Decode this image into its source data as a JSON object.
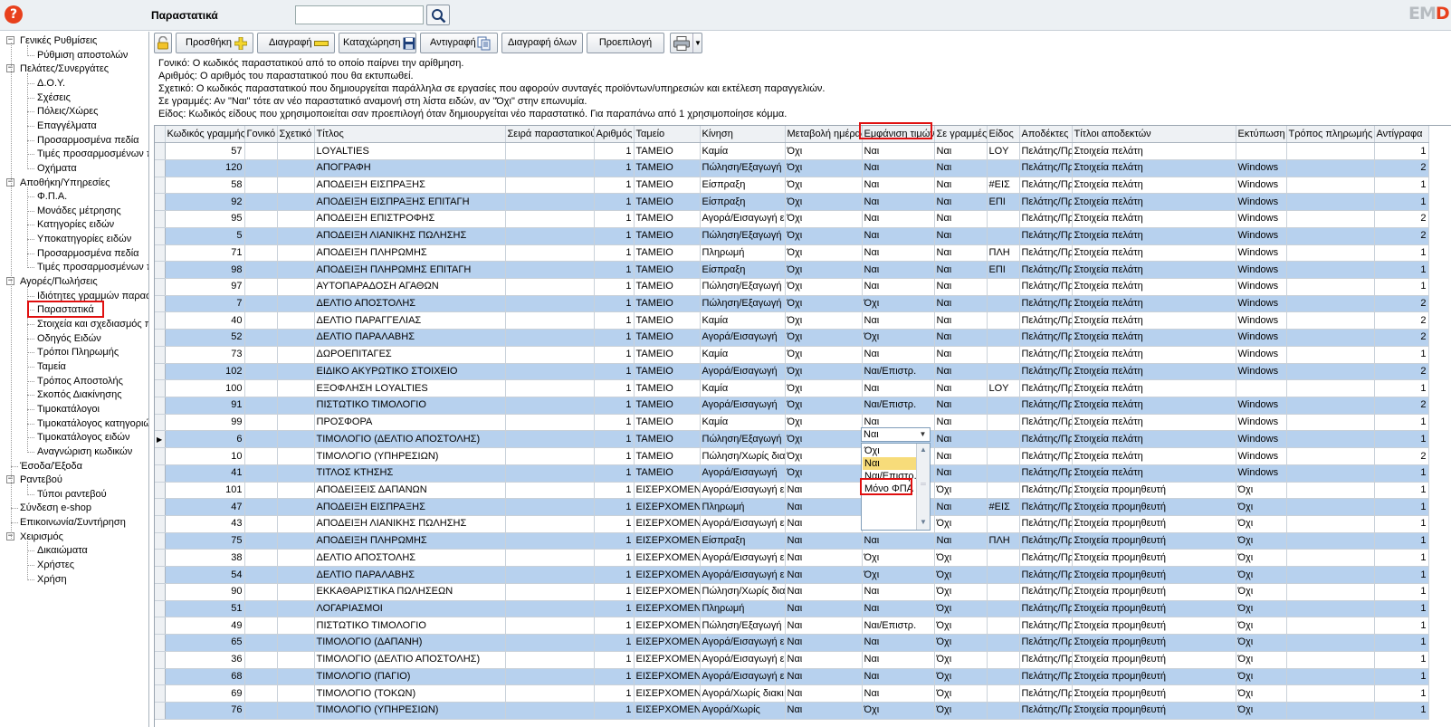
{
  "header": {
    "title": "Παραστατικά",
    "search": {
      "value": "",
      "placeholder": ""
    },
    "logo": {
      "main": "EM",
      "accent": "D"
    }
  },
  "sidebar": {
    "nodes": [
      {
        "label": "Γενικές Ρυθμίσεις",
        "level": 0,
        "toggle": "−"
      },
      {
        "label": "Ρύθμιση αποστολών",
        "level": 1
      },
      {
        "label": "Πελάτες/Συνεργάτες",
        "level": 0,
        "toggle": "−"
      },
      {
        "label": "Δ.Ο.Υ.",
        "level": 1
      },
      {
        "label": "Σχέσεις",
        "level": 1
      },
      {
        "label": "Πόλεις/Χώρες",
        "level": 1
      },
      {
        "label": "Επαγγέλματα",
        "level": 1
      },
      {
        "label": "Προσαρμοσμένα πεδία",
        "level": 1
      },
      {
        "label": "Τιμές προσαρμοσμένων πεδίων",
        "level": 1
      },
      {
        "label": "Οχήματα",
        "level": 1
      },
      {
        "label": "Αποθήκη/Υπηρεσίες",
        "level": 0,
        "toggle": "−"
      },
      {
        "label": "Φ.Π.Α.",
        "level": 1
      },
      {
        "label": "Μονάδες μέτρησης",
        "level": 1
      },
      {
        "label": "Κατηγορίες ειδών",
        "level": 1
      },
      {
        "label": "Υποκατηγορίες ειδών",
        "level": 1
      },
      {
        "label": "Προσαρμοσμένα πεδία",
        "level": 1
      },
      {
        "label": "Τιμές προσαρμοσμένων πεδίων",
        "level": 1
      },
      {
        "label": "Αγορές/Πωλήσεις",
        "level": 0,
        "toggle": "−"
      },
      {
        "label": "Ιδιότητες γραμμών παραστατικών",
        "level": 1
      },
      {
        "label": "Παραστατικά",
        "level": 1,
        "selected": true
      },
      {
        "label": "Στοιχεία και σχεδιασμός παραστατικών",
        "level": 1
      },
      {
        "label": "Οδηγός Ειδών",
        "level": 1
      },
      {
        "label": "Τρόποι Πληρωμής",
        "level": 1
      },
      {
        "label": "Ταμεία",
        "level": 1
      },
      {
        "label": "Τρόπος Αποστολής",
        "level": 1
      },
      {
        "label": "Σκοπός Διακίνησης",
        "level": 1
      },
      {
        "label": "Τιμοκατάλογοι",
        "level": 1
      },
      {
        "label": "Τιμοκατάλογος κατηγοριών",
        "level": 1
      },
      {
        "label": "Τιμοκατάλογος ειδών",
        "level": 1
      },
      {
        "label": "Αναγνώριση κωδικών",
        "level": 1
      },
      {
        "label": "Έσοδα/Έξοδα",
        "level": 0
      },
      {
        "label": "Ραντεβού",
        "level": 0,
        "toggle": "−"
      },
      {
        "label": "Τύποι ραντεβού",
        "level": 1
      },
      {
        "label": "Σύνδεση e-shop",
        "level": 0
      },
      {
        "label": "Επικοινωνία/Συντήρηση",
        "level": 0
      },
      {
        "label": "Χειρισμός",
        "level": 0,
        "toggle": "−"
      },
      {
        "label": "Δικαιώματα",
        "level": 1
      },
      {
        "label": "Χρήστες",
        "level": 1
      },
      {
        "label": "Χρήση",
        "level": 1
      }
    ]
  },
  "toolbar": {
    "add": "Προσθήκη",
    "delete": "Διαγραφή",
    "save": "Καταχώρηση",
    "copy": "Αντιγραφή",
    "delete_all": "Διαγραφή όλων",
    "default": "Προεπιλογή"
  },
  "info": [
    "Γονικό: Ο κωδικός παραστατικού από το οποίο παίρνει την αρίθμηση.",
    "Αριθμός: Ο αριθμός του παραστατικού που θα εκτυπωθεί.",
    "Σχετικό: Ο κωδικός παραστατικού που δημιουργείται παράλληλα σε εργασίες που αφορούν συνταγές προϊόντων/υπηρεσιών και εκτέλεση παραγγελιών.",
    "Σε γραμμές: Αν \"Ναι\" τότε αν νέο παραστατικό αναμονή στη λίστα ειδών, αν \"Όχι\" στην επωνυμία.",
    "Είδος: Κωδικός είδους που χρησιμοποιείται σαν προεπιλογή όταν δημιουργείται νέο παραστατικό. Για παραπάνω από 1 χρησιμοποίησε κόμμα."
  ],
  "grid": {
    "columns": [
      "Κωδικός γραμμής",
      "Γονικό",
      "Σχετικό",
      "Τίτλος",
      "Σειρά παραστατικού",
      "Αριθμός",
      "Ταμείο",
      "Κίνηση",
      "Μεταβολή ημέρας",
      "Εμφάνιση τιμών",
      "Σε γραμμές",
      "Είδος",
      "Αποδέκτες",
      "Τίτλοι αποδεκτών",
      "Εκτύπωση",
      "Τρόπος πληρωμής",
      "Αντίγραφα"
    ],
    "rows": [
      [
        "57",
        "",
        "",
        "LOYALTIES",
        "",
        "1",
        "ΤΑΜΕΙΟ",
        "Καμία",
        "Όχι",
        "Ναι",
        "Ναι",
        "LOY",
        "Πελάτης/Πρ",
        "Στοιχεία πελάτη",
        "",
        "",
        "1"
      ],
      [
        "120",
        "",
        "",
        "ΑΠΟΓΡΑΦΗ",
        "",
        "1",
        "ΤΑΜΕΙΟ",
        "Πώληση/Εξαγωγή",
        "Όχι",
        "Ναι",
        "Ναι",
        "",
        "Πελάτης/Πρ",
        "Στοιχεία πελάτη",
        "Windows",
        "",
        "2"
      ],
      [
        "58",
        "",
        "",
        "ΑΠΟΔΕΙΞΗ ΕΙΣΠΡΑΞΗΣ",
        "",
        "1",
        "ΤΑΜΕΙΟ",
        "Είσπραξη",
        "Όχι",
        "Ναι",
        "Ναι",
        "#ΕΙΣ",
        "Πελάτης/Πρ",
        "Στοιχεία πελάτη",
        "Windows",
        "",
        "1"
      ],
      [
        "92",
        "",
        "",
        "ΑΠΟΔΕΙΞΗ ΕΙΣΠΡΑΞΗΣ ΕΠΙΤΑΓΗ",
        "",
        "1",
        "ΤΑΜΕΙΟ",
        "Είσπραξη",
        "Όχι",
        "Ναι",
        "Ναι",
        "ΕΠΙ",
        "Πελάτης/Πρ",
        "Στοιχεία πελάτη",
        "Windows",
        "",
        "1"
      ],
      [
        "95",
        "",
        "",
        "ΑΠΟΔΕΙΞΗ ΕΠΙΣΤΡΟΦΗΣ",
        "",
        "1",
        "ΤΑΜΕΙΟ",
        "Αγορά/Εισαγωγή ε",
        "Όχι",
        "Ναι",
        "Ναι",
        "",
        "Πελάτης/Πρ",
        "Στοιχεία πελάτη",
        "Windows",
        "",
        "2"
      ],
      [
        "5",
        "",
        "",
        "ΑΠΟΔΕΙΞΗ ΛΙΑΝΙΚΗΣ ΠΩΛΗΣΗΣ",
        "",
        "1",
        "ΤΑΜΕΙΟ",
        "Πώληση/Εξαγωγή",
        "Όχι",
        "Ναι",
        "Ναι",
        "",
        "Πελάτης/Πρ",
        "Στοιχεία πελάτη",
        "Windows",
        "",
        "2"
      ],
      [
        "71",
        "",
        "",
        "ΑΠΟΔΕΙΞΗ ΠΛΗΡΩΜΗΣ",
        "",
        "1",
        "ΤΑΜΕΙΟ",
        "Πληρωμή",
        "Όχι",
        "Ναι",
        "Ναι",
        "ΠΛΗ",
        "Πελάτης/Πρ",
        "Στοιχεία πελάτη",
        "Windows",
        "",
        "1"
      ],
      [
        "98",
        "",
        "",
        "ΑΠΟΔΕΙΞΗ ΠΛΗΡΩΜΗΣ ΕΠΙΤΑΓΗ",
        "",
        "1",
        "ΤΑΜΕΙΟ",
        "Είσπραξη",
        "Όχι",
        "Ναι",
        "Ναι",
        "ΕΠΙ",
        "Πελάτης/Πρ",
        "Στοιχεία πελάτη",
        "Windows",
        "",
        "1"
      ],
      [
        "97",
        "",
        "",
        "ΑΥΤΟΠΑΡΑΔΟΣΗ ΑΓΑΘΩΝ",
        "",
        "1",
        "ΤΑΜΕΙΟ",
        "Πώληση/Εξαγωγή ε",
        "Όχι",
        "Ναι",
        "Ναι",
        "",
        "Πελάτης/Πρ",
        "Στοιχεία πελάτη",
        "Windows",
        "",
        "1"
      ],
      [
        "7",
        "",
        "",
        "ΔΕΛΤΙΟ ΑΠΟΣΤΟΛΗΣ",
        "",
        "1",
        "ΤΑΜΕΙΟ",
        "Πώληση/Εξαγωγή",
        "Όχι",
        "Όχι",
        "Ναι",
        "",
        "Πελάτης/Πρ",
        "Στοιχεία πελάτη",
        "Windows",
        "",
        "2"
      ],
      [
        "40",
        "",
        "",
        "ΔΕΛΤΙΟ ΠΑΡΑΓΓΕΛΙΑΣ",
        "",
        "1",
        "ΤΑΜΕΙΟ",
        "Καμία",
        "Όχι",
        "Ναι",
        "Ναι",
        "",
        "Πελάτης/Πρ",
        "Στοιχεία πελάτη",
        "Windows",
        "",
        "2"
      ],
      [
        "52",
        "",
        "",
        "ΔΕΛΤΙΟ ΠΑΡΑΛΑΒΗΣ",
        "",
        "1",
        "ΤΑΜΕΙΟ",
        "Αγορά/Εισαγωγή",
        "Όχι",
        "Όχι",
        "Ναι",
        "",
        "Πελάτης/Πρ",
        "Στοιχεία πελάτη",
        "Windows",
        "",
        "2"
      ],
      [
        "73",
        "",
        "",
        "ΔΩΡΟΕΠΙΤΑΓΕΣ",
        "",
        "1",
        "ΤΑΜΕΙΟ",
        "Καμία",
        "Όχι",
        "Ναι",
        "Ναι",
        "",
        "Πελάτης/Πρ",
        "Στοιχεία πελάτη",
        "Windows",
        "",
        "1"
      ],
      [
        "102",
        "",
        "",
        "ΕΙΔΙΚΟ ΑΚΥΡΩΤΙΚΟ ΣΤΟΙΧΕΙΟ",
        "",
        "1",
        "ΤΑΜΕΙΟ",
        "Αγορά/Εισαγωγή",
        "Όχι",
        "Ναι/Επιστρ.",
        "Ναι",
        "",
        "Πελάτης/Πρ",
        "Στοιχεία πελάτη",
        "Windows",
        "",
        "2"
      ],
      [
        "100",
        "",
        "",
        "ΕΞΟΦΛΗΣΗ LOYALTIES",
        "",
        "1",
        "ΤΑΜΕΙΟ",
        "Καμία",
        "Όχι",
        "Ναι",
        "Ναι",
        "LOY",
        "Πελάτης/Πρ",
        "Στοιχεία πελάτη",
        "",
        "",
        "1"
      ],
      [
        "91",
        "",
        "",
        "ΠΙΣΤΩΤΙΚΟ ΤΙΜΟΛΟΓΙΟ",
        "",
        "1",
        "ΤΑΜΕΙΟ",
        "Αγορά/Εισαγωγή",
        "Όχι",
        "Ναι/Επιστρ.",
        "Ναι",
        "",
        "Πελάτης/Πρ",
        "Στοιχεία πελάτη",
        "Windows",
        "",
        "2"
      ],
      [
        "99",
        "",
        "",
        "ΠΡΟΣΦΟΡΑ",
        "",
        "1",
        "ΤΑΜΕΙΟ",
        "Καμία",
        "Όχι",
        "Ναι",
        "Ναι",
        "",
        "Πελάτης/Πρ",
        "Στοιχεία πελάτη",
        "Windows",
        "",
        "1"
      ],
      [
        "6",
        "",
        "",
        "ΤΙΜΟΛΟΓΙΟ (ΔΕΛΤΙΟ ΑΠΟΣΤΟΛΗΣ)",
        "",
        "1",
        "ΤΑΜΕΙΟ",
        "Πώληση/Εξαγωγή",
        "Όχι",
        "",
        "Ναι",
        "",
        "Πελάτης/Πρ",
        "Στοιχεία πελάτη",
        "Windows",
        "",
        "1"
      ],
      [
        "10",
        "",
        "",
        "ΤΙΜΟΛΟΓΙΟ (ΥΠΗΡΕΣΙΩΝ)",
        "",
        "1",
        "ΤΑΜΕΙΟ",
        "Πώληση/Χωρίς διακ",
        "Όχι",
        "",
        "Ναι",
        "",
        "Πελάτης/Πρ",
        "Στοιχεία πελάτη",
        "Windows",
        "",
        "2"
      ],
      [
        "41",
        "",
        "",
        "ΤΙΤΛΟΣ ΚΤΗΣΗΣ",
        "",
        "1",
        "ΤΑΜΕΙΟ",
        "Αγορά/Εισαγωγή",
        "Όχι",
        "",
        "Ναι",
        "",
        "Πελάτης/Πρ",
        "Στοιχεία πελάτη",
        "Windows",
        "",
        "1"
      ],
      [
        "101",
        "",
        "",
        "ΑΠΟΔΕΙΞΕΙΣ ΔΑΠΑΝΩΝ",
        "",
        "1",
        "ΕΙΣΕΡΧΟΜΕΝΑ",
        "Αγορά/Εισαγωγή ε",
        "Ναι",
        "",
        "Όχι",
        "",
        "Πελάτης/Πρ",
        "Στοιχεία προμηθευτή",
        "Όχι",
        "",
        "1"
      ],
      [
        "47",
        "",
        "",
        "ΑΠΟΔΕΙΞΗ ΕΙΣΠΡΑΞΗΣ",
        "",
        "1",
        "ΕΙΣΕΡΧΟΜΕΝΑ",
        "Πληρωμή",
        "Ναι",
        "",
        "Ναι",
        "#ΕΙΣ",
        "Πελάτης/Πρ",
        "Στοιχεία προμηθευτή",
        "Όχι",
        "",
        "1"
      ],
      [
        "43",
        "",
        "",
        "ΑΠΟΔΕΙΞΗ ΛΙΑΝΙΚΗΣ ΠΩΛΗΣΗΣ",
        "",
        "1",
        "ΕΙΣΕΡΧΟΜΕΝΑ",
        "Αγορά/Εισαγωγή ε",
        "Ναι",
        "",
        "Όχι",
        "",
        "Πελάτης/Πρ",
        "Στοιχεία προμηθευτή",
        "Όχι",
        "",
        "1"
      ],
      [
        "75",
        "",
        "",
        "ΑΠΟΔΕΙΞΗ ΠΛΗΡΩΜΗΣ",
        "",
        "1",
        "ΕΙΣΕΡΧΟΜΕΝΑ",
        "Είσπραξη",
        "Ναι",
        "Ναι",
        "Ναι",
        "ΠΛΗ",
        "Πελάτης/Πρ",
        "Στοιχεία προμηθευτή",
        "Όχι",
        "",
        "1"
      ],
      [
        "38",
        "",
        "",
        "ΔΕΛΤΙΟ ΑΠΟΣΤΟΛΗΣ",
        "",
        "1",
        "ΕΙΣΕΡΧΟΜΕΝΑ",
        "Αγορά/Εισαγωγή ε",
        "Ναι",
        "Όχι",
        "Όχι",
        "",
        "Πελάτης/Πρ",
        "Στοιχεία προμηθευτή",
        "Όχι",
        "",
        "1"
      ],
      [
        "54",
        "",
        "",
        "ΔΕΛΤΙΟ ΠΑΡΑΛΑΒΗΣ",
        "",
        "1",
        "ΕΙΣΕΡΧΟΜΕΝΑ",
        "Αγορά/Εισαγωγή ε",
        "Ναι",
        "Όχι",
        "Όχι",
        "",
        "Πελάτης/Πρ",
        "Στοιχεία προμηθευτή",
        "Όχι",
        "",
        "1"
      ],
      [
        "90",
        "",
        "",
        "ΕΚΚΑΘΑΡΙΣΤΙΚΑ ΠΩΛΗΣΕΩΝ",
        "",
        "1",
        "ΕΙΣΕΡΧΟΜΕΝΑ",
        "Πώληση/Χωρίς διακ",
        "Ναι",
        "Ναι",
        "Όχι",
        "",
        "Πελάτης/Πρ",
        "Στοιχεία προμηθευτή",
        "Όχι",
        "",
        "1"
      ],
      [
        "51",
        "",
        "",
        "ΛΟΓΑΡΙΑΣΜΟΙ",
        "",
        "1",
        "ΕΙΣΕΡΧΟΜΕΝΑ",
        "Πληρωμή",
        "Ναι",
        "Ναι",
        "Όχι",
        "",
        "Πελάτης/Πρ",
        "Στοιχεία προμηθευτή",
        "Όχι",
        "",
        "1"
      ],
      [
        "49",
        "",
        "",
        "ΠΙΣΤΩΤΙΚΟ ΤΙΜΟΛΟΓΙΟ",
        "",
        "1",
        "ΕΙΣΕΡΧΟΜΕΝΑ",
        "Πώληση/Εξαγωγή ε",
        "Ναι",
        "Ναι/Επιστρ.",
        "Όχι",
        "",
        "Πελάτης/Πρ",
        "Στοιχεία προμηθευτή",
        "Όχι",
        "",
        "1"
      ],
      [
        "65",
        "",
        "",
        "ΤΙΜΟΛΟΓΙΟ (ΔΑΠΑΝΗ)",
        "",
        "1",
        "ΕΙΣΕΡΧΟΜΕΝΑ",
        "Αγορά/Εισαγωγή ε",
        "Ναι",
        "Ναι",
        "Όχι",
        "",
        "Πελάτης/Πρ",
        "Στοιχεία προμηθευτή",
        "Όχι",
        "",
        "1"
      ],
      [
        "36",
        "",
        "",
        "ΤΙΜΟΛΟΓΙΟ (ΔΕΛΤΙΟ ΑΠΟΣΤΟΛΗΣ)",
        "",
        "1",
        "ΕΙΣΕΡΧΟΜΕΝΑ",
        "Αγορά/Εισαγωγή ε",
        "Ναι",
        "Ναι",
        "Όχι",
        "",
        "Πελάτης/Πρ",
        "Στοιχεία προμηθευτή",
        "Όχι",
        "",
        "1"
      ],
      [
        "68",
        "",
        "",
        "ΤΙΜΟΛΟΓΙΟ (ΠΑΓΙΟ)",
        "",
        "1",
        "ΕΙΣΕΡΧΟΜΕΝΑ",
        "Αγορά/Εισαγωγή ε",
        "Ναι",
        "Ναι",
        "Όχι",
        "",
        "Πελάτης/Πρ",
        "Στοιχεία προμηθευτή",
        "Όχι",
        "",
        "1"
      ],
      [
        "69",
        "",
        "",
        "ΤΙΜΟΛΟΓΙΟ (ΤΟΚΩΝ)",
        "",
        "1",
        "ΕΙΣΕΡΧΟΜΕΝΑ",
        "Αγορά/Χωρίς διακι",
        "Ναι",
        "Ναι",
        "Όχι",
        "",
        "Πελάτης/Πρ",
        "Στοιχεία προμηθευτή",
        "Όχι",
        "",
        "1"
      ],
      [
        "76",
        "",
        "",
        "ΤΙΜΟΛΟΓΙΟ (ΥΠΗΡΕΣΙΩΝ)",
        "",
        "1",
        "ΕΙΣΕΡΧΟΜΕΝΑ",
        "Αγορά/Χωρίς",
        "Ναι",
        "Όχι",
        "Όχι",
        "",
        "Πελάτης/Πρ",
        "Στοιχεία προμηθευτή",
        "Όχι",
        "",
        "1"
      ]
    ],
    "current_row": 17
  },
  "dropdown": {
    "current": "Ναι",
    "options": [
      "Όχι",
      "Ναι",
      "Ναι/Επιστρ.",
      "Μόνο ΦΠΑ"
    ],
    "selected_index": 1
  },
  "colors": {
    "row_alt": "#b7d1ee",
    "highlight": "#e01010",
    "dropdown_selected": "#f7dc7a"
  }
}
